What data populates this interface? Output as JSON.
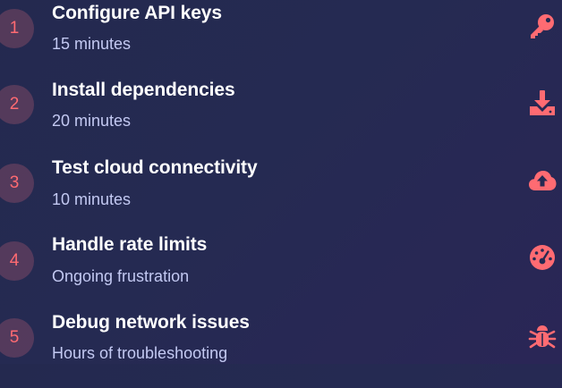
{
  "accent_color": "#ff6b72",
  "steps": [
    {
      "number": "1",
      "title": "Configure API keys",
      "subtitle": "15 minutes",
      "icon": "key-icon"
    },
    {
      "number": "2",
      "title": "Install dependencies",
      "subtitle": "20 minutes",
      "icon": "download-icon"
    },
    {
      "number": "3",
      "title": "Test cloud connectivity",
      "subtitle": "10 minutes",
      "icon": "cloud-upload-icon"
    },
    {
      "number": "4",
      "title": "Handle rate limits",
      "subtitle": "Ongoing frustration",
      "icon": "gauge-icon"
    },
    {
      "number": "5",
      "title": "Debug network issues",
      "subtitle": "Hours of troubleshooting",
      "icon": "bug-icon"
    }
  ]
}
